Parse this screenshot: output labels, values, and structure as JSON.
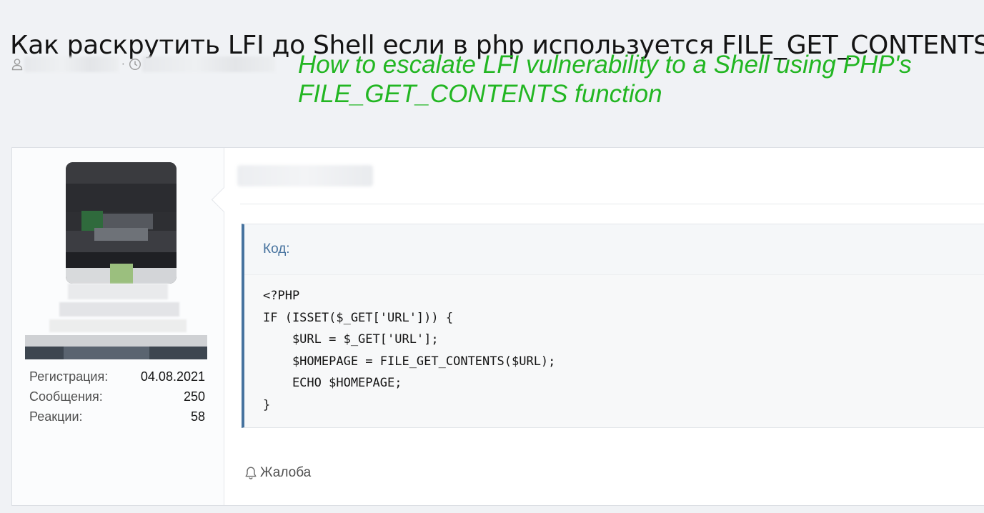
{
  "thread": {
    "title": "Как раскрутить LFI до Shell если в php используется FILE_GET_CONTENTS"
  },
  "meta": {
    "user_icon": "user-icon",
    "clock_icon": "clock-icon",
    "separator": "·"
  },
  "annotation": {
    "translation": "How to escalate LFI vulnerability to a Shell using PHP's FILE_GET_CONTENTS function",
    "color": "#22b622"
  },
  "user": {
    "stats": [
      {
        "label": "Регистрация:",
        "value": "04.08.2021"
      },
      {
        "label": "Сообщения:",
        "value": "250"
      },
      {
        "label": "Реакции:",
        "value": "58"
      }
    ]
  },
  "post": {
    "code_label": "Код:",
    "code_lines": [
      "<?PHP",
      "IF (ISSET($_GET['URL'])) {",
      "    $URL = $_GET['URL'];",
      "    $HOMEPAGE = FILE_GET_CONTENTS($URL);",
      "    ECHO $HOMEPAGE;",
      "}"
    ],
    "report_label": "Жалоба",
    "report_icon": "bell-icon",
    "accent_color": "#47739f"
  }
}
